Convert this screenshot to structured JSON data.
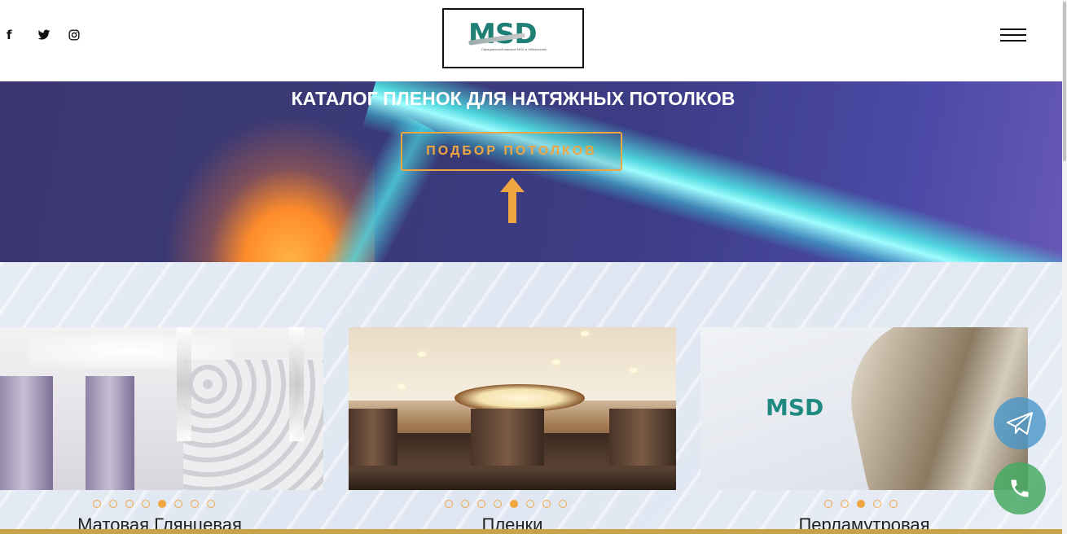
{
  "header": {
    "social": [
      {
        "name": "facebook-icon",
        "glyph": "f"
      },
      {
        "name": "twitter-icon",
        "glyph": "🐦"
      },
      {
        "name": "instagram-icon",
        "glyph": "◎"
      }
    ],
    "logo": {
      "text": "MSD",
      "subtitle": "Официальный магазин MSD в Узбекистане"
    },
    "menu_icon": "hamburger-menu-icon"
  },
  "hero": {
    "title": "КАТАЛОГ ПЛЕНОК ДЛЯ НАТЯЖНЫХ ПОТОЛКОВ",
    "button_label": "ПОДБОР ПОТОЛКОВ",
    "accent_color": "#f0a640"
  },
  "catalog": {
    "cards": [
      {
        "title": "Матовая Глянцевая",
        "dots_total": 8,
        "active_dot": 5
      },
      {
        "title": "Пленки",
        "dots_total": 8,
        "active_dot": 5
      },
      {
        "title": "Перламутровая",
        "dots_total": 5,
        "active_dot": 3
      }
    ],
    "card3_image_logo": "MSD"
  },
  "floating": {
    "telegram_icon": "telegram-icon",
    "phone_icon": "phone-icon"
  }
}
